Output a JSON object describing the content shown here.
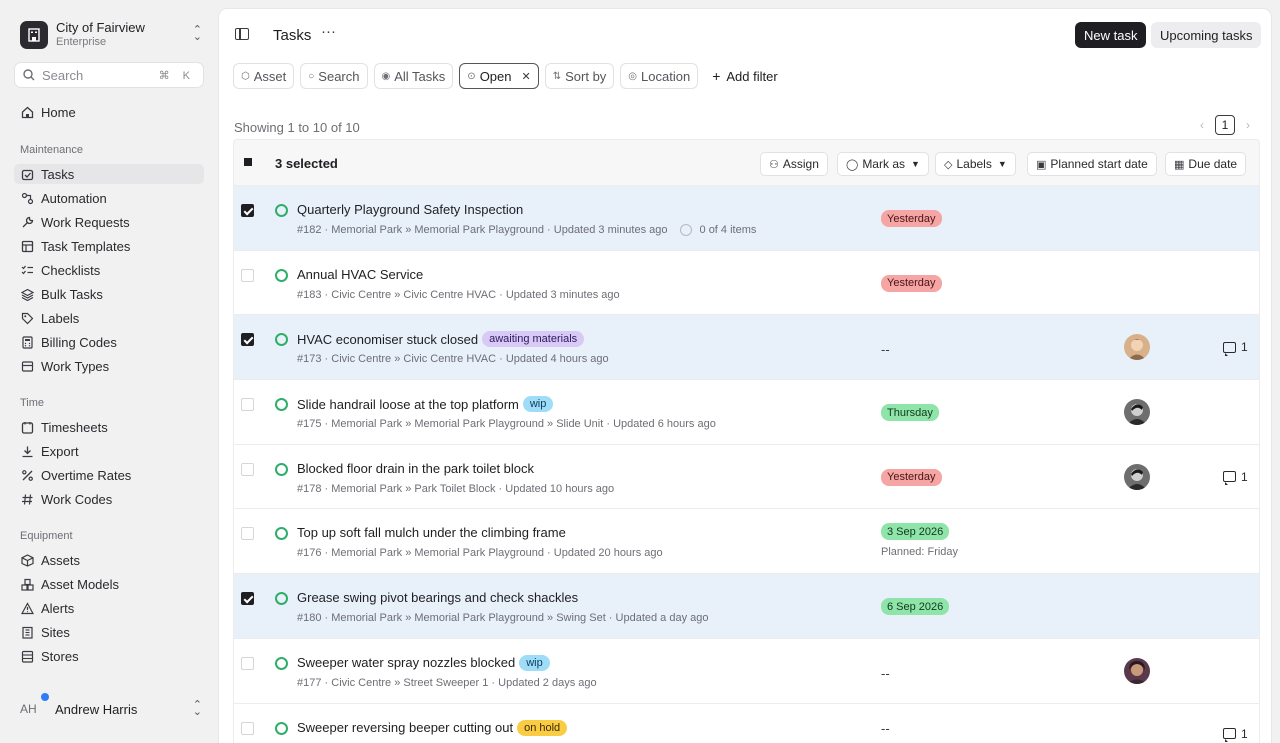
{
  "org": {
    "name": "City of Fairview",
    "plan": "Enterprise"
  },
  "search": {
    "placeholder": "Search",
    "shortcut": "⌘ K"
  },
  "nav": {
    "home": "Home",
    "maintenance_title": "Maintenance",
    "maintenance": [
      "Tasks",
      "Automation",
      "Work Requests",
      "Task Templates",
      "Checklists",
      "Bulk Tasks",
      "Labels",
      "Billing Codes",
      "Work Types"
    ],
    "time_title": "Time",
    "time": [
      "Timesheets",
      "Export",
      "Overtime Rates",
      "Work Codes"
    ],
    "equipment_title": "Equipment",
    "equipment": [
      "Assets",
      "Asset Models",
      "Alerts",
      "Sites",
      "Stores"
    ],
    "active": "Tasks"
  },
  "user": {
    "initials": "AH",
    "name": "Andrew Harris"
  },
  "header": {
    "title": "Tasks",
    "new_task": "New task",
    "upcoming": "Upcoming tasks"
  },
  "filters": {
    "asset": "Asset",
    "search": "Search",
    "all_tasks": "All Tasks",
    "open": "Open",
    "sort_by": "Sort by",
    "location": "Location",
    "add_filter": "Add filter"
  },
  "list": {
    "showing": "Showing 1 to 10 of 10",
    "page": "1"
  },
  "toolbar": {
    "selected": "3 selected",
    "assign": "Assign",
    "mark_as": "Mark as",
    "labels": "Labels",
    "planned_start": "Planned start date",
    "due_date": "Due date"
  },
  "tasks": [
    {
      "title": "Quarterly Playground Safety Inspection",
      "tag": "",
      "meta": "#182 · Memorial Park » Memorial Park Playground · Updated 3 minutes ago",
      "progress": "0 of 4 items",
      "date": "Yesterday",
      "date_color": "red",
      "planned": "",
      "comments": "",
      "selected": true
    },
    {
      "title": "Annual HVAC Service",
      "tag": "",
      "meta": "#183 · Civic Centre » Civic Centre HVAC · Updated 3 minutes ago",
      "progress": "",
      "date": "Yesterday",
      "date_color": "red",
      "planned": "",
      "comments": "",
      "selected": false
    },
    {
      "title": "HVAC economiser stuck closed",
      "tag": "awaiting materials",
      "tag_color": "purple",
      "meta": "#173 · Civic Centre » Civic Centre HVAC · Updated 4 hours ago",
      "progress": "",
      "date": "--",
      "planned": "",
      "comments": "1",
      "selected": true
    },
    {
      "title": "Slide handrail loose at the top platform",
      "tag": "wip",
      "tag_color": "blue",
      "meta": "#175 · Memorial Park » Memorial Park Playground » Slide Unit · Updated 6 hours ago",
      "progress": "",
      "date": "Thursday",
      "date_color": "green",
      "planned": "",
      "comments": "",
      "selected": false
    },
    {
      "title": "Blocked floor drain in the park toilet block",
      "tag": "",
      "meta": "#178 · Memorial Park » Park Toilet Block · Updated 10 hours ago",
      "progress": "",
      "date": "Yesterday",
      "date_color": "red",
      "planned": "",
      "comments": "1",
      "selected": false
    },
    {
      "title": "Top up soft fall mulch under the climbing frame",
      "tag": "",
      "meta": "#176 · Memorial Park » Memorial Park Playground · Updated 20 hours ago",
      "progress": "",
      "date": "3 Sep 2026",
      "date_color": "green",
      "planned": "Planned: Friday",
      "comments": "",
      "selected": false
    },
    {
      "title": "Grease swing pivot bearings and check shackles",
      "tag": "",
      "meta": "#180 · Memorial Park » Memorial Park Playground » Swing Set · Updated a day ago",
      "progress": "",
      "date": "6 Sep 2026",
      "date_color": "green",
      "planned": "",
      "comments": "",
      "selected": true
    },
    {
      "title": "Sweeper water spray nozzles blocked",
      "tag": "wip",
      "tag_color": "blue",
      "meta": "#177 · Civic Centre » Street Sweeper 1 · Updated 2 days ago",
      "progress": "",
      "date": "--",
      "planned": "",
      "comments": "",
      "selected": false
    },
    {
      "title": "Sweeper reversing beeper cutting out",
      "tag": "on hold",
      "tag_color": "yellow",
      "meta": "",
      "progress": "",
      "date": "--",
      "planned": "",
      "comments": "1",
      "selected": false
    }
  ],
  "colors": {
    "accent_selected_row": "#e8f0fa",
    "status_open": "#2fae6a",
    "badge_overdue": "#f5a5a3",
    "badge_upcoming": "#8fe4a9"
  }
}
